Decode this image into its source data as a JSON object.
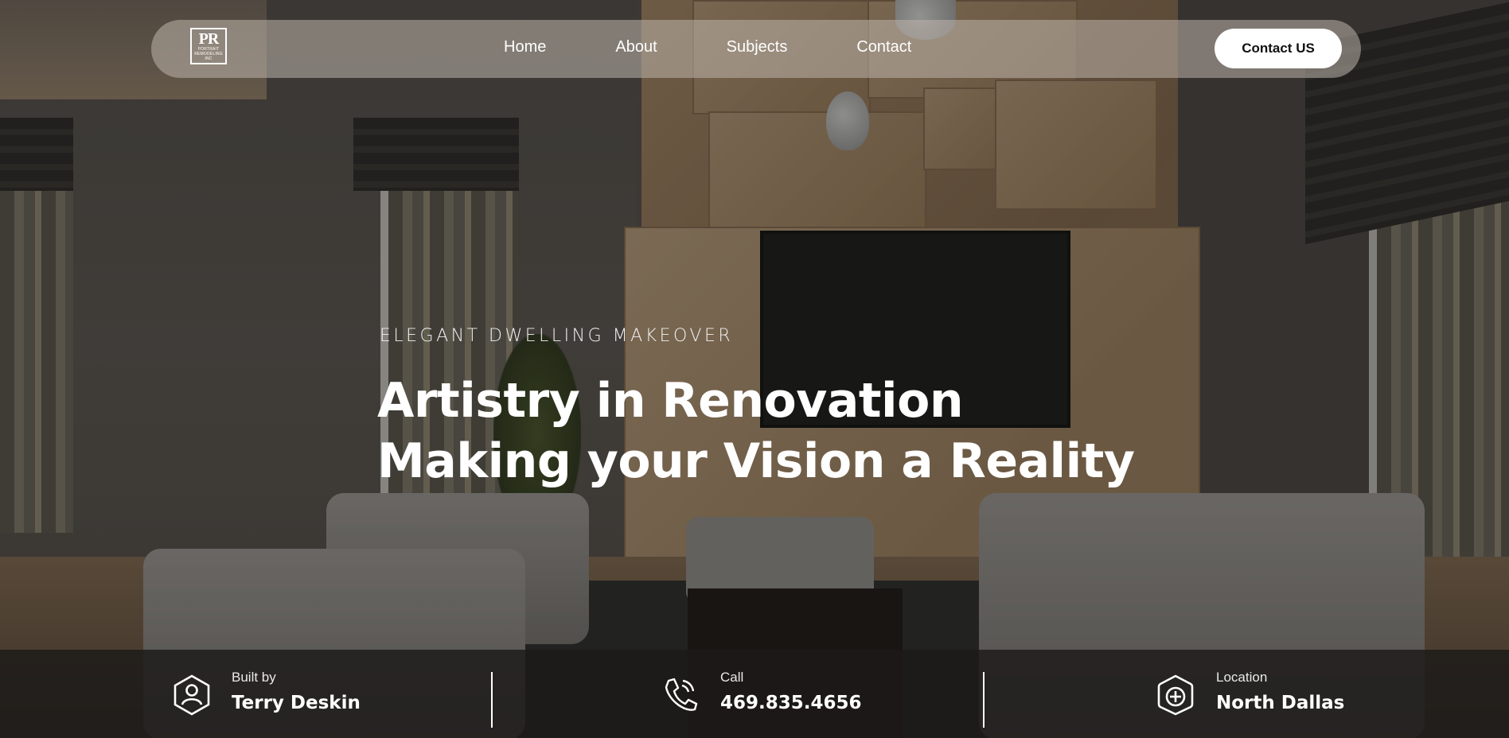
{
  "nav": {
    "logo_text": "PR",
    "logo_subtext": "PORTRAIT REMODELING INC",
    "links": [
      "Home",
      "About",
      "Subjects",
      "Contact"
    ],
    "cta_label": "Contact US"
  },
  "hero": {
    "eyebrow": "ELEGANT DWELLING MAKEOVER",
    "title_line1": "Artistry in Renovation",
    "title_line2": "Making your Vision a Reality"
  },
  "info": {
    "builder": {
      "label": "Built by",
      "value": "Terry Deskin",
      "icon": "person-hexagon-icon"
    },
    "call": {
      "label": "Call",
      "value": "469.835.4656",
      "icon": "phone-icon"
    },
    "location": {
      "label": "Location",
      "value": "North Dallas",
      "icon": "location-hexagon-icon"
    }
  },
  "colors": {
    "nav_bg": "#BEB4AC",
    "cta_bg": "#FFFFFF",
    "cta_text": "#111111",
    "info_bar_bg": "#1C1A19",
    "text": "#FFFFFF"
  }
}
